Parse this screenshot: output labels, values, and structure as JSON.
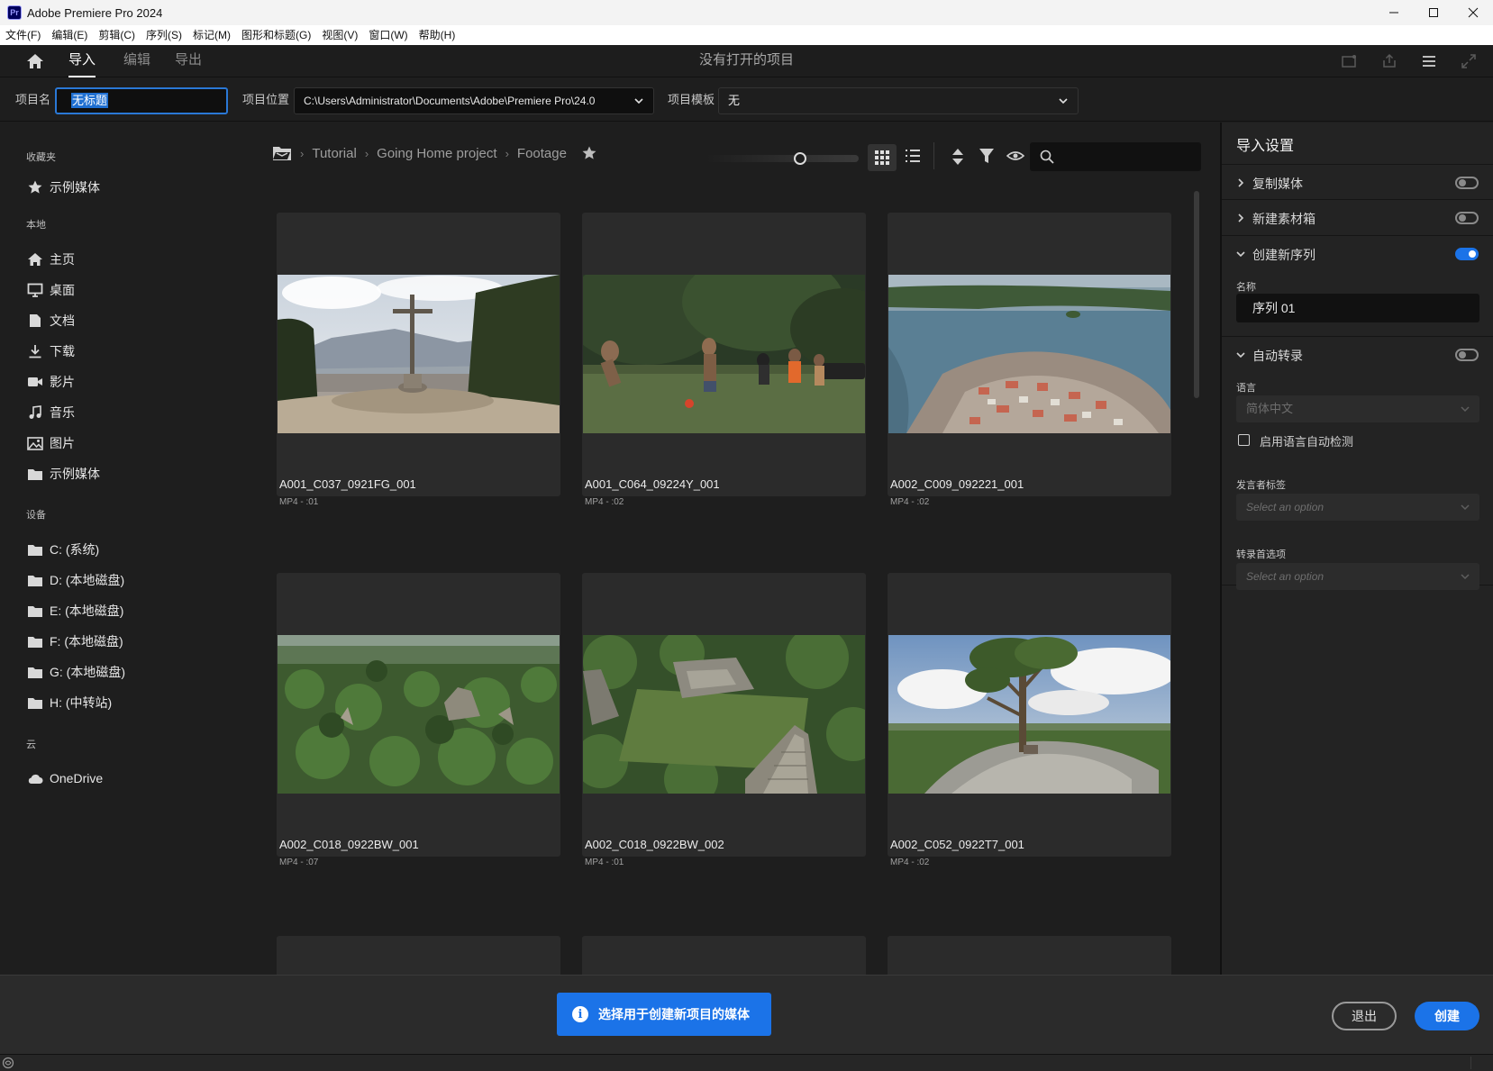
{
  "window": {
    "title": "Adobe Premiere Pro 2024",
    "app_icon_text": "Pr"
  },
  "menu": [
    "文件(F)",
    "编辑(E)",
    "剪辑(C)",
    "序列(S)",
    "标记(M)",
    "图形和标题(G)",
    "视图(V)",
    "窗口(W)",
    "帮助(H)"
  ],
  "nav": {
    "tabs": [
      "导入",
      "编辑",
      "导出"
    ],
    "active_tab": "导入",
    "center_title": "没有打开的项目"
  },
  "project": {
    "name_label": "项目名",
    "name_value": "无标题",
    "location_label": "项目位置",
    "location_value": "C:\\Users\\Administrator\\Documents\\Adobe\\Premiere Pro\\24.0",
    "template_label": "项目模板",
    "template_value": "无"
  },
  "sidebar": {
    "favorites_title": "收藏夹",
    "favorites": [
      {
        "label": "示例媒体",
        "icon": "star-icon"
      }
    ],
    "local_title": "本地",
    "local": [
      {
        "label": "主页",
        "icon": "home-icon"
      },
      {
        "label": "桌面",
        "icon": "desktop-icon"
      },
      {
        "label": "文档",
        "icon": "document-icon"
      },
      {
        "label": "下载",
        "icon": "download-icon"
      },
      {
        "label": "影片",
        "icon": "video-icon"
      },
      {
        "label": "音乐",
        "icon": "music-icon"
      },
      {
        "label": "图片",
        "icon": "image-icon"
      },
      {
        "label": "示例媒体",
        "icon": "folder-icon"
      }
    ],
    "devices_title": "设备",
    "devices": [
      {
        "label": "C: (系统)",
        "icon": "folder-icon"
      },
      {
        "label": "D: (本地磁盘)",
        "icon": "folder-icon"
      },
      {
        "label": "E: (本地磁盘)",
        "icon": "folder-icon"
      },
      {
        "label": "F: (本地磁盘)",
        "icon": "folder-icon"
      },
      {
        "label": "G: (本地磁盘)",
        "icon": "folder-icon"
      },
      {
        "label": "H: (中转站)",
        "icon": "folder-icon"
      }
    ],
    "cloud_title": "云",
    "cloud": [
      {
        "label": "OneDrive",
        "icon": "cloud-icon"
      }
    ]
  },
  "browser": {
    "breadcrumbs": [
      "Tutorial",
      "Going Home project",
      "Footage"
    ],
    "thumbnail_size_level": 0.62,
    "view_mode": "grid",
    "search": {
      "placeholder": ""
    },
    "media": [
      {
        "name": "A001_C037_0921FG_001",
        "meta": "MP4 - :01",
        "scene": "cross-overlook"
      },
      {
        "name": "A001_C064_09224Y_001",
        "meta": "MP4 - :02",
        "scene": "kids-soccer"
      },
      {
        "name": "A002_C009_092221_001",
        "meta": "MP4 - :02",
        "scene": "island-town-aerial"
      },
      {
        "name": "A002_C018_0922BW_001",
        "meta": "MP4 - :07",
        "scene": "jungle-aerial"
      },
      {
        "name": "A002_C018_0922BW_002",
        "meta": "MP4 - :01",
        "scene": "temple-aerial"
      },
      {
        "name": "A002_C052_0922T7_001",
        "meta": "MP4 - :02",
        "scene": "tree-on-rock"
      }
    ]
  },
  "import_settings": {
    "title": "导入设置",
    "copy_media": {
      "label": "复制媒体",
      "on": false
    },
    "new_bin": {
      "label": "新建素材箱",
      "on": false
    },
    "new_sequence": {
      "label": "创建新序列",
      "on": true,
      "name_label": "名称",
      "name_value": "序列 01"
    },
    "auto_transcribe": {
      "label": "自动转录",
      "on": false,
      "language_label": "语言",
      "language_value": "简体中文",
      "auto_detect_label": "启用语言自动检测",
      "speaker_label": "发言者标签",
      "speaker_placeholder": "Select an option",
      "pref_label": "转录首选项",
      "pref_placeholder": "Select an option"
    }
  },
  "footer": {
    "info_text": "选择用于创建新项目的媒体",
    "exit_label": "退出",
    "create_label": "创建"
  },
  "colors": {
    "accent": "#1b73e8",
    "bg": "#1e1e1e",
    "panel": "#232323"
  }
}
